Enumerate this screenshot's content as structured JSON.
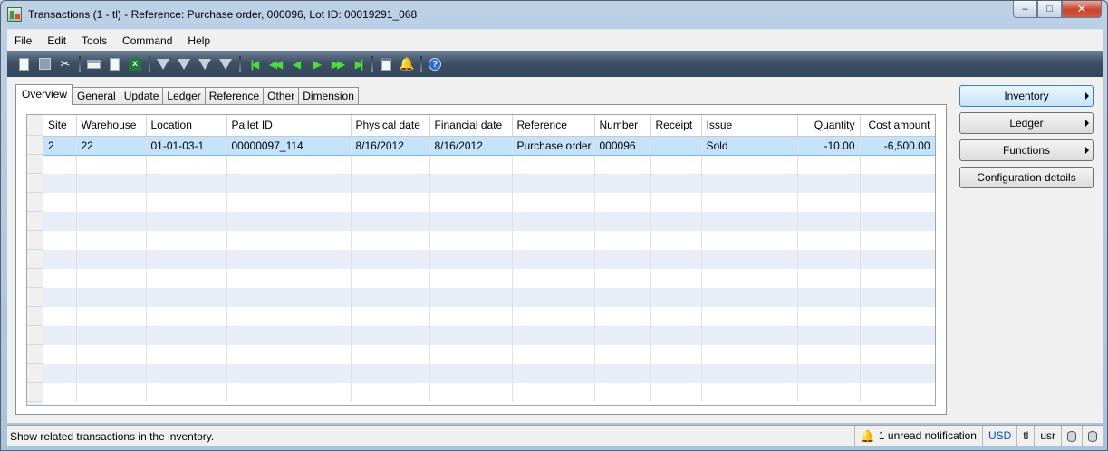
{
  "window": {
    "title": "Transactions (1 - tl) - Reference: Purchase order, 000096, Lot ID: 00019291_068",
    "controls": {
      "minimize": "–",
      "maximize": "□",
      "close": "✕"
    }
  },
  "menu": [
    "File",
    "Edit",
    "Tools",
    "Command",
    "Help"
  ],
  "tabs": [
    "Overview",
    "General",
    "Update",
    "Ledger",
    "Reference",
    "Other",
    "Dimension"
  ],
  "grid": {
    "columns": [
      "Site",
      "Warehouse",
      "Location",
      "Pallet ID",
      "Physical date",
      "Financial date",
      "Reference",
      "Number",
      "Receipt",
      "Issue",
      "Quantity",
      "Cost amount"
    ],
    "rows": [
      [
        "2",
        "22",
        "01-01-03-1",
        "00000097_114",
        "8/16/2012",
        "8/16/2012",
        "Purchase order",
        "000096",
        "",
        "Sold",
        "-10.00",
        "-6,500.00"
      ]
    ]
  },
  "side_buttons": {
    "inventory": "Inventory",
    "ledger": "Ledger",
    "functions": "Functions",
    "configuration": "Configuration details"
  },
  "status": {
    "help_text": "Show related transactions in the inventory.",
    "notifications": "1 unread notification",
    "currency": "USD",
    "company": "tl",
    "user": "usr"
  }
}
